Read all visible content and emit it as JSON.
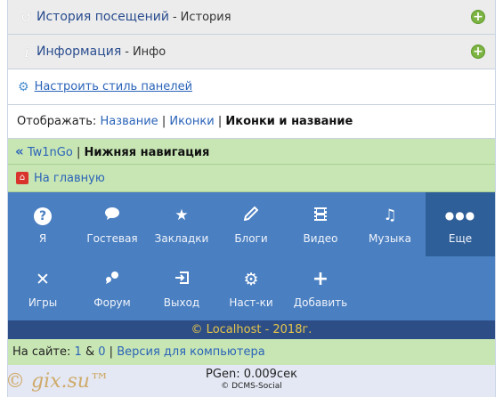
{
  "panels": [
    {
      "title": "История посещений",
      "sep": "-",
      "sub": "История",
      "icon": "history-icon"
    },
    {
      "title": "Информация",
      "sep": "-",
      "sub": "Инфо",
      "icon": "info-icon"
    }
  ],
  "settings_link": "Настроить стиль панелей",
  "display": {
    "label": "Отображать:",
    "opt_name": "Название",
    "divider": "|",
    "opt_icons": "Иконки",
    "current": "Иконки и название"
  },
  "nav": {
    "arrows": "«",
    "site": "Tw1nGo",
    "divider": "|",
    "title": "Нижняя навигация",
    "home": "На главную"
  },
  "menu_row1": [
    {
      "label": "Я",
      "icon": "question-icon",
      "glyph": "?"
    },
    {
      "label": "Гостевая",
      "icon": "chat-icon",
      "glyph": "💬"
    },
    {
      "label": "Закладки",
      "icon": "star-icon",
      "glyph": "★"
    },
    {
      "label": "Блоги",
      "icon": "pencil-icon",
      "glyph": "✎"
    },
    {
      "label": "Видео",
      "icon": "film-icon",
      "glyph": "▦"
    },
    {
      "label": "Музыка",
      "icon": "music-icon",
      "glyph": "♫"
    },
    {
      "label": "Еще",
      "icon": "more-icon",
      "glyph": "•••"
    }
  ],
  "menu_row2": [
    {
      "label": "Игры",
      "icon": "close-x-icon",
      "glyph": "✕"
    },
    {
      "label": "Форум",
      "icon": "forum-icon",
      "glyph": "❜"
    },
    {
      "label": "Выход",
      "icon": "logout-icon",
      "glyph": "⇱"
    },
    {
      "label": "Наст-ки",
      "icon": "gear-icon",
      "glyph": "⚙"
    },
    {
      "label": "Добавить",
      "icon": "plus-icon",
      "glyph": "+"
    }
  ],
  "footer": {
    "copyright": "© Localhost - 2018г.",
    "online_label": "На сайте:",
    "online_users": "1",
    "amp": "&",
    "online_guests": "0",
    "divider": "|",
    "desktop": "Версия для компьютера",
    "pgen": "PGen: 0.009сек",
    "dcms": "© DCMS-Social"
  },
  "watermark": "© gix.su™",
  "colors": {
    "menu_bg": "#4a7fc1",
    "menu_active": "#2f5f98",
    "green_row": "#c8e6b4",
    "copy_bar": "#2c4d86",
    "copy_text": "#e8c64a"
  }
}
